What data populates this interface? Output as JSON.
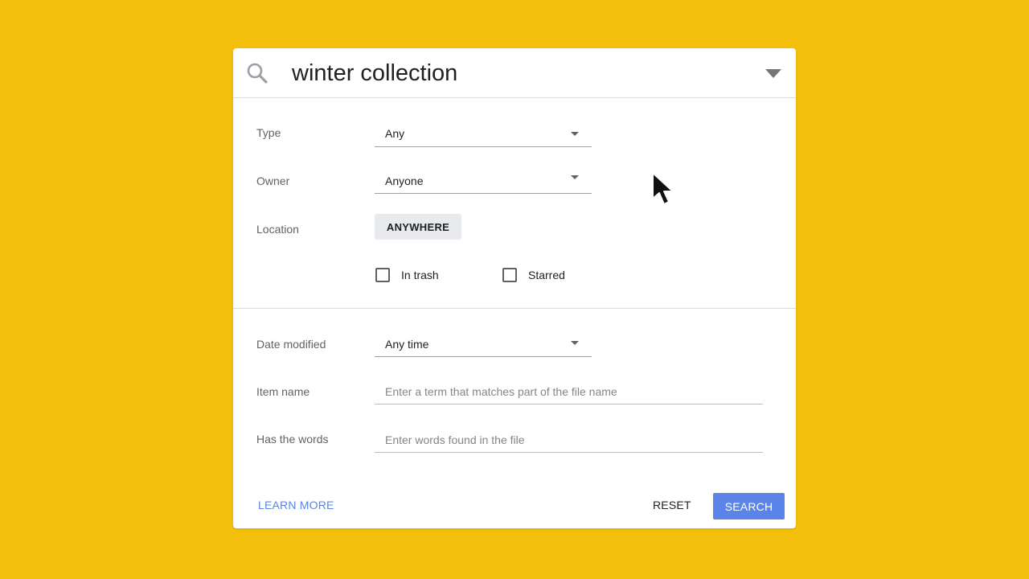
{
  "search": {
    "query": "winter collection"
  },
  "filters": {
    "type": {
      "label": "Type",
      "value": "Any"
    },
    "owner": {
      "label": "Owner",
      "value": "Anyone"
    },
    "location": {
      "label": "Location",
      "value": "ANYWHERE"
    },
    "in_trash": {
      "label": "In trash",
      "checked": false
    },
    "starred": {
      "label": "Starred",
      "checked": false
    },
    "date_modified": {
      "label": "Date modified",
      "value": "Any time"
    },
    "item_name": {
      "label": "Item name",
      "placeholder": "Enter a term that matches part of the file name"
    },
    "has_words": {
      "label": "Has the words",
      "placeholder": "Enter words found in the file"
    }
  },
  "actions": {
    "learn_more": "LEARN MORE",
    "reset": "RESET",
    "search": "SEARCH"
  },
  "colors": {
    "background": "#F5C00D",
    "accent": "#5B84E8"
  },
  "icons": {
    "search": "search-icon",
    "options": "caret-down-icon",
    "pointer": "mouse-pointer-icon"
  }
}
